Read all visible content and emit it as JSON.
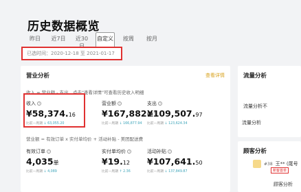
{
  "page": {
    "title": "历史数据概览"
  },
  "tabs": [
    {
      "label": "昨日",
      "active": false
    },
    {
      "label": "近7日",
      "active": false
    },
    {
      "label": "近30日",
      "active": false
    },
    {
      "label": "自定义",
      "active": true
    },
    {
      "label": "按周",
      "active": false
    },
    {
      "label": "按月",
      "active": false
    }
  ],
  "date_range": "已选时间：2020-12-18 至 2021-01-17",
  "business": {
    "title": "营业分析",
    "detail_link": "查看详情",
    "formula1": "收入 = 营业额 - 支出，点击\"查看详情\"可查看历史收入明细",
    "formula2": "营业额 = 有效订单 x 实付单均价 + 活动补贴 - 美团配送费",
    "metrics_row1": [
      {
        "label": "收入",
        "int": "¥58,374.",
        "dec": "16",
        "compare": "比前一周期",
        "delta": "↓ 63,055.20"
      },
      {
        "label": "营业额",
        "int": "¥167,882.",
        "dec": "13",
        "compare": "比前一周期",
        "delta": "↓ 166,877.94"
      },
      {
        "label": "支出",
        "int": "¥109,507.",
        "dec": "97",
        "compare": "比前一周期",
        "delta": "↓ 123,624.34"
      }
    ],
    "metrics_row2": [
      {
        "label": "有效订单",
        "int": "4,035",
        "dec": "单",
        "compare": "比前一周期",
        "delta": "↓ 4,089"
      },
      {
        "label": "实付单均价",
        "int": "¥19.",
        "dec": "12",
        "compare": "比前一周期",
        "delta": "↑ 2.36"
      },
      {
        "label": "活动补贴",
        "int": "¥107,641.",
        "dec": "50",
        "compare": "比前一周期",
        "delta": "↓ 137,849.87"
      }
    ]
  },
  "flow": {
    "title": "流量分析",
    "text1": "流量分析不",
    "text2": "流量分析"
  },
  "customer": {
    "title": "顾客分析",
    "rank": "#38",
    "name": "王** (尾号",
    "tag": "新客首单",
    "bottom": "顾客分析"
  }
}
